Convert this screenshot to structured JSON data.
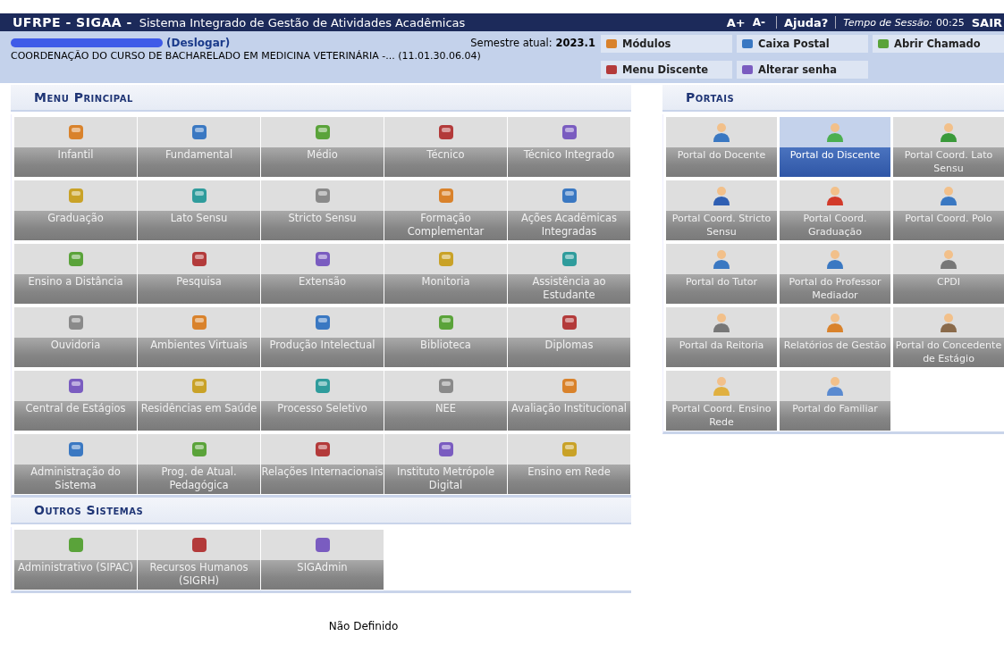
{
  "top_bar": {
    "brand": "UFRPE - SIGAA -",
    "title": "Sistema Integrado de Gestão de Atividades Acadêmicas",
    "font_up": "A+",
    "font_down": "A-",
    "help": "Ajuda?",
    "session_label": "Tempo de Sessão:",
    "session_time": "00:25",
    "logout": "SAIR"
  },
  "info_bar": {
    "logout_link": "(Deslogar)",
    "semester_label": "Semestre atual:",
    "semester": "2023.1",
    "unit": "COORDENAÇÃO DO CURSO DE BACHARELADO EM MEDICINA VETERINÁRIA -... (11.01.30.06.04)",
    "shortcuts": [
      {
        "label": "Módulos"
      },
      {
        "label": "Caixa Postal"
      },
      {
        "label": "Abrir Chamado"
      },
      {
        "label": "Menu Discente"
      },
      {
        "label": "Alterar senha"
      }
    ]
  },
  "main_menu": {
    "title": "Menu Principal",
    "items": [
      {
        "label": "Infantil"
      },
      {
        "label": "Fundamental"
      },
      {
        "label": "Médio"
      },
      {
        "label": "Técnico"
      },
      {
        "label": "Técnico Integrado"
      },
      {
        "label": "Graduação"
      },
      {
        "label": "Lato Sensu"
      },
      {
        "label": "Stricto Sensu"
      },
      {
        "label": "Formação Complementar"
      },
      {
        "label": "Ações Acadêmicas Integradas"
      },
      {
        "label": "Ensino a Distância"
      },
      {
        "label": "Pesquisa"
      },
      {
        "label": "Extensão"
      },
      {
        "label": "Monitoria"
      },
      {
        "label": "Assistência ao Estudante"
      },
      {
        "label": "Ouvidoria"
      },
      {
        "label": "Ambientes Virtuais"
      },
      {
        "label": "Produção Intelectual"
      },
      {
        "label": "Biblioteca"
      },
      {
        "label": "Diplomas"
      },
      {
        "label": "Central de Estágios"
      },
      {
        "label": "Residências em Saúde"
      },
      {
        "label": "Processo Seletivo"
      },
      {
        "label": "NEE"
      },
      {
        "label": "Avaliação Institucional"
      },
      {
        "label": "Administração do Sistema"
      },
      {
        "label": "Prog. de Atual. Pedagógica"
      },
      {
        "label": "Relações Internacionais"
      },
      {
        "label": "Instituto Metrópole Digital"
      },
      {
        "label": "Ensino em Rede"
      }
    ]
  },
  "other_systems": {
    "title": "Outros Sistemas",
    "items": [
      {
        "label": "Administrativo (SIPAC)"
      },
      {
        "label": "Recursos Humanos (SIGRH)"
      },
      {
        "label": "SIGAdmin"
      }
    ]
  },
  "portals": {
    "title": "Portais",
    "items": [
      {
        "label": "Portal do Docente",
        "selected": false
      },
      {
        "label": "Portal do Discente",
        "selected": true
      },
      {
        "label": "Portal Coord. Lato Sensu",
        "selected": false
      },
      {
        "label": "Portal Coord. Stricto Sensu",
        "selected": false
      },
      {
        "label": "Portal Coord. Graduação",
        "selected": false
      },
      {
        "label": "Portal Coord. Polo",
        "selected": false
      },
      {
        "label": "Portal do Tutor",
        "selected": false
      },
      {
        "label": "Portal do Professor Mediador",
        "selected": false
      },
      {
        "label": "CPDI",
        "selected": false
      },
      {
        "label": "Portal da Reitoria",
        "selected": false
      },
      {
        "label": "Relatórios de Gestão",
        "selected": false
      },
      {
        "label": "Portal do Concedente de Estágio",
        "selected": false
      },
      {
        "label": "Portal Coord. Ensino Rede",
        "selected": false
      },
      {
        "label": "Portal do Familiar",
        "selected": false
      }
    ]
  },
  "footer": {
    "text": "Não Definido"
  }
}
